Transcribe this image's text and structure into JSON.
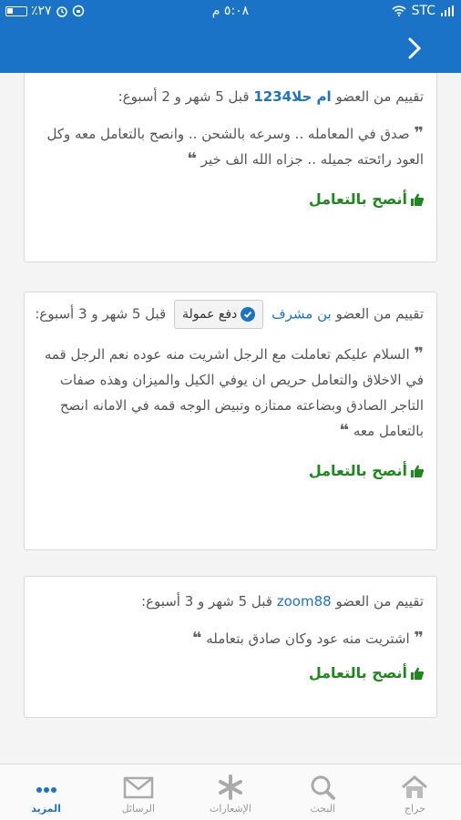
{
  "status_bar": {
    "battery": "٪٢٧",
    "time": "٥:٠٨ م",
    "carrier": "STC"
  },
  "reviews": [
    {
      "prefix": "تقييم من العضو",
      "member": "ام حلا1234",
      "timing": "قبل 5 شهر و 2 أسبوع:",
      "text": "صدق في المعامله .. وسرعه بالشحن .. وانصح بالتعامل معه وكل العود رائحته جميله .. جزاه الله الف خير",
      "recommendation": "أنصح بالتعامل"
    },
    {
      "prefix": "تقييم من العضو",
      "member": "بن مشرف",
      "badge": "دفع عمولة",
      "timing": "قبل 5 شهر و 3 أسبوع:",
      "text": "السلام عليكم تعاملت مع الرجل اشريت منه عوده نعم الرجل قمه في الاخلاق والتعامل حريص ان يوفي الكيل والميزان وهذه صفات التاجر الصادق وبضاعته ممتازه وتبيض الوجه قمه في الامانه انصح بالتعامل معه",
      "recommendation": "أنصح بالتعامل"
    },
    {
      "prefix": "تقييم من العضو",
      "member": "zoom88",
      "timing": "قبل 5 شهر و 3 أسبوع:",
      "text": "اشتريت منه عود وكان صادق بتعامله",
      "recommendation": "أنصح بالتعامل"
    }
  ],
  "tabs": [
    {
      "label": "حراج",
      "icon": "home-icon"
    },
    {
      "label": "البحث",
      "icon": "search-icon"
    },
    {
      "label": "الإشعارات",
      "icon": "asterisk-icon"
    },
    {
      "label": "الرسائل",
      "icon": "mail-icon"
    },
    {
      "label": "المزيد",
      "icon": "more-icon"
    }
  ],
  "colors": {
    "accent": "#1a73c6",
    "recommend": "#1b8a1b"
  }
}
